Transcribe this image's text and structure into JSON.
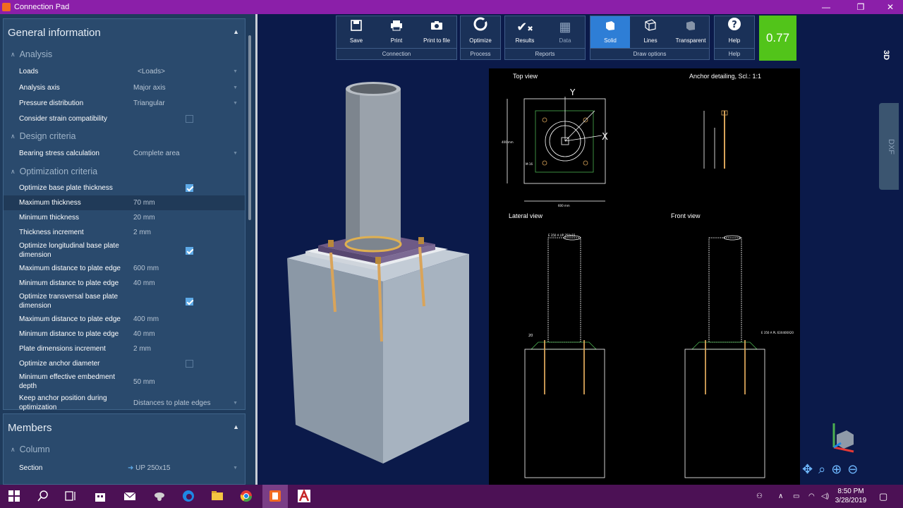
{
  "window": {
    "title": "Connection Pad"
  },
  "panel": {
    "general": {
      "title": "General information",
      "analysis": {
        "title": "Analysis",
        "rows": [
          {
            "label": "Loads",
            "value": "<Loads>"
          },
          {
            "label": "Analysis axis",
            "value": "Major axis"
          },
          {
            "label": "Pressure distribution",
            "value": "Triangular"
          },
          {
            "label": "Consider strain compatibility",
            "value": ""
          }
        ]
      },
      "design": {
        "title": "Design criteria",
        "rows": [
          {
            "label": "Bearing stress calculation",
            "value": "Complete area"
          }
        ]
      },
      "optimization": {
        "title": "Optimization criteria",
        "rows": [
          {
            "label": "Optimize base plate thickness",
            "value": ""
          },
          {
            "label": "Maximum thickness",
            "value": "70 mm"
          },
          {
            "label": "Minimum thickness",
            "value": "20 mm"
          },
          {
            "label": "Thickness increment",
            "value": "2 mm"
          },
          {
            "label": "Optimize longitudinal base plate dimension",
            "value": ""
          },
          {
            "label": "Maximum distance to plate edge",
            "value": "600 mm"
          },
          {
            "label": "Minimum distance to plate edge",
            "value": "40 mm"
          },
          {
            "label": "Optimize transversal base plate dimension",
            "value": ""
          },
          {
            "label": "Maximum distance to plate edge",
            "value": "400 mm"
          },
          {
            "label": "Minimum distance to plate edge",
            "value": "40 mm"
          },
          {
            "label": "Plate dimensions increment",
            "value": "2 mm"
          },
          {
            "label": "Optimize anchor diameter",
            "value": ""
          },
          {
            "label": "Minimum effective embedment depth",
            "value": "50 mm"
          },
          {
            "label": "Keep anchor position during optimization",
            "value": "Distances to plate edges"
          }
        ]
      }
    },
    "members": {
      "title": "Members",
      "column": {
        "title": "Column",
        "rows": [
          {
            "label": "Section",
            "value": "UP 250x15"
          }
        ]
      }
    }
  },
  "toolbar": {
    "connection": {
      "caption": "Connection",
      "save": "Save",
      "print": "Print",
      "print_to_file": "Print to file"
    },
    "process": {
      "caption": "Process",
      "optimize": "Optimize"
    },
    "reports": {
      "caption": "Reports",
      "results": "Results",
      "data": "Data"
    },
    "draw": {
      "caption": "Draw options",
      "solid": "Solid",
      "lines": "Lines",
      "transparent": "Transparent"
    },
    "help": {
      "caption": "Help",
      "help": "Help"
    },
    "score": "0.77"
  },
  "view": {
    "mode_3d": "3D",
    "dxf_tab": "DXF"
  },
  "drawing": {
    "top_view": "Top view",
    "anchor_detailing": "Anchor detailing, Scl.: 1:1",
    "lateral_view": "Lateral view",
    "front_view": "Front view",
    "axis_y": "Y",
    "axis_x": "X",
    "dim_600": "600 mm",
    "dim_400": "400 mm",
    "dim_m16": "M-16",
    "dim_20": "20",
    "lbl_lateral": "E 350 A\nUP 250x15",
    "lbl_front": "E 350 A\nPL 63X400X20"
  },
  "taskbar": {
    "time": "8:50 PM",
    "date": "3/28/2019"
  },
  "colors": {
    "titlebar": "#8b1fa9",
    "panel": "#1f3b5c",
    "viewport": "#0b1a4a",
    "score": "#52c41a",
    "accent": "#2e7ed6"
  }
}
